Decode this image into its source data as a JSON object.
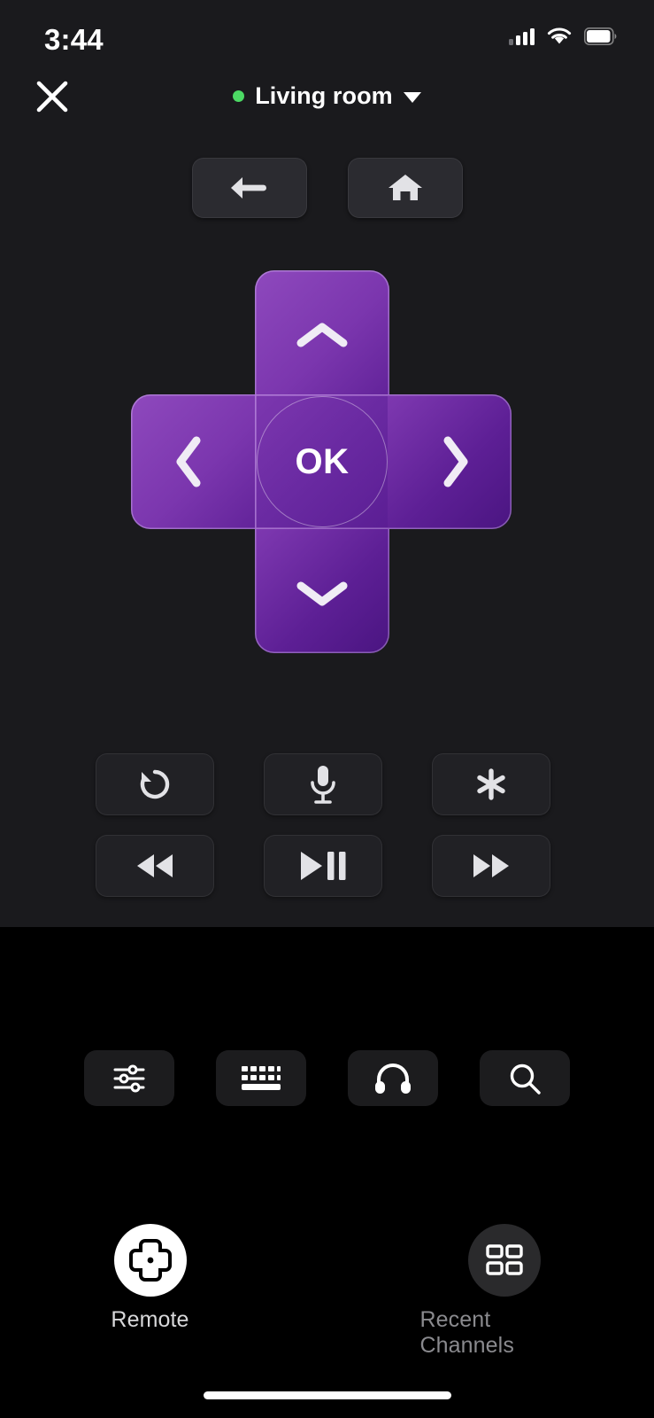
{
  "status_bar": {
    "time": "3:44",
    "signal_icon": "cellular-signal-icon",
    "wifi_icon": "wifi-icon",
    "battery_icon": "battery-icon"
  },
  "header": {
    "close_icon": "close-icon",
    "device_name": "Living room",
    "status_dot_color": "#4cd964",
    "caret_icon": "chevron-down-icon"
  },
  "nav_row": [
    {
      "name": "back-button",
      "icon": "back-arrow-icon"
    },
    {
      "name": "home-button",
      "icon": "home-icon"
    }
  ],
  "dpad": {
    "up": "dpad-up-button",
    "down": "dpad-down-button",
    "left": "dpad-left-button",
    "right": "dpad-right-button",
    "ok_label": "OK",
    "gradient_from": "#8e49bd",
    "gradient_to": "#4a1581"
  },
  "function_buttons": [
    {
      "name": "instant-replay-button",
      "icon": "replay-icon"
    },
    {
      "name": "voice-search-button",
      "icon": "microphone-icon"
    },
    {
      "name": "options-button",
      "icon": "asterisk-icon"
    },
    {
      "name": "rewind-button",
      "icon": "rewind-icon"
    },
    {
      "name": "play-pause-button",
      "icon": "play-pause-icon"
    },
    {
      "name": "fast-forward-button",
      "icon": "fast-forward-icon"
    }
  ],
  "tool_buttons": [
    {
      "name": "settings-button",
      "icon": "sliders-icon"
    },
    {
      "name": "keyboard-button",
      "icon": "keyboard-icon"
    },
    {
      "name": "private-listening-button",
      "icon": "headphones-icon"
    },
    {
      "name": "search-button",
      "icon": "search-icon"
    }
  ],
  "tabs": [
    {
      "name": "tab-remote",
      "label": "Remote",
      "icon": "dpad-icon",
      "active": true
    },
    {
      "name": "tab-recent-channels",
      "label": "Recent Channels",
      "icon": "grid-icon",
      "active": false
    }
  ]
}
